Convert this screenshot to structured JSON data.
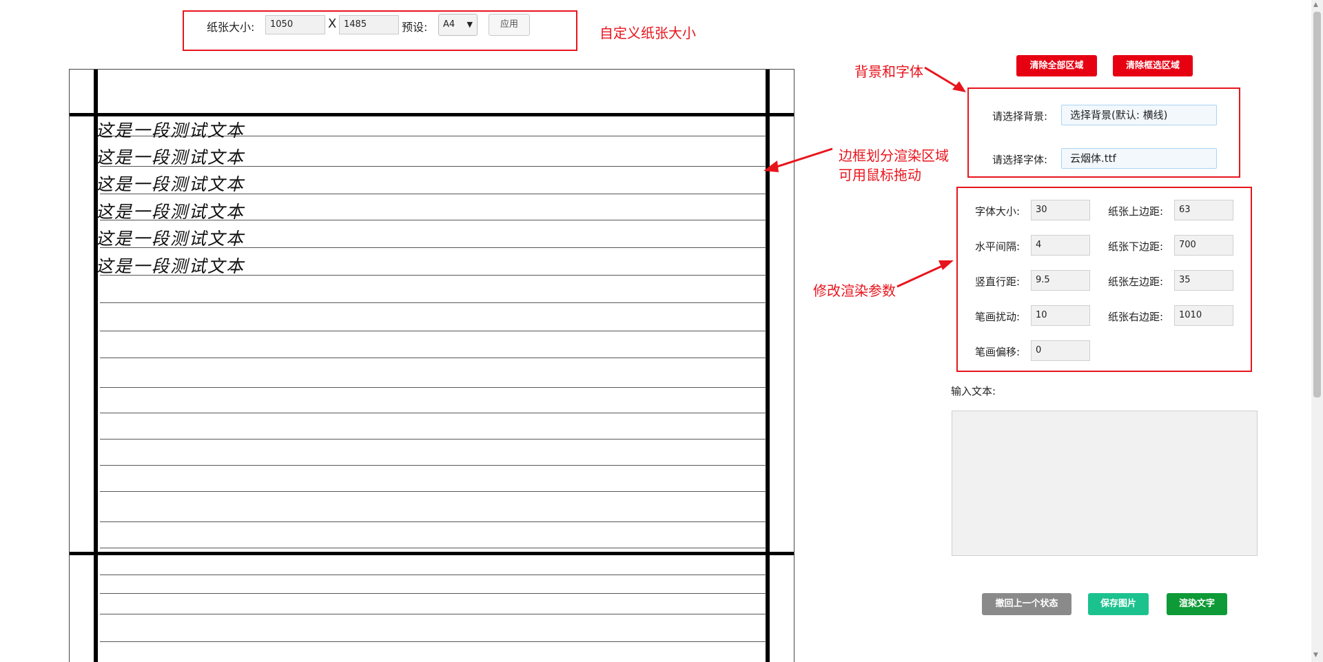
{
  "paper_size": {
    "label": "纸张大小:",
    "width": "1050",
    "times": "X",
    "height": "1485",
    "preset_label": "预设:",
    "preset_value": "A4",
    "apply_label": "应用"
  },
  "annotations": {
    "custom_size": "自定义纸张大小",
    "bg_font": "背景和字体",
    "border_line1": "边框划分渲染区域",
    "border_line2": "可用鼠标拖动",
    "params": "修改渲染参数"
  },
  "canvas": {
    "lines": [
      "这是一段测试文本",
      "这是一段测试文本",
      "这是一段测试文本",
      "这是一段测试文本",
      "这是一段测试文本",
      "这是一段测试文本"
    ]
  },
  "toolbar": {
    "clear_all": "清除全部区域",
    "clear_selected": "清除框选区域"
  },
  "selectors": {
    "bg_label": "请选择背景:",
    "bg_value": "选择背景(默认: 横线)",
    "font_label": "请选择字体:",
    "font_value": "云烟体.ttf"
  },
  "params": {
    "font_size_label": "字体大小:",
    "font_size": "30",
    "top_margin_label": "纸张上边距:",
    "top_margin": "63",
    "h_spacing_label": "水平间隔:",
    "h_spacing": "4",
    "bottom_margin_label": "纸张下边距:",
    "bottom_margin": "700",
    "line_spacing_label": "竖直行距:",
    "line_spacing": "9.5",
    "left_margin_label": "纸张左边距:",
    "left_margin": "35",
    "stroke_jitter_label": "笔画扰动:",
    "stroke_jitter": "10",
    "right_margin_label": "纸张右边距:",
    "right_margin": "1010",
    "stroke_offset_label": "笔画偏移:",
    "stroke_offset": "0"
  },
  "text_input": {
    "label": "输入文本:",
    "value": ""
  },
  "actions": {
    "undo": "撤回上一个状态",
    "save": "保存图片",
    "render": "渲染文字"
  },
  "colors": {
    "accent_red": "#e60012",
    "undo_gray": "#8a8a8a",
    "save_teal": "#1bc28e",
    "render_green": "#0e9a36"
  }
}
